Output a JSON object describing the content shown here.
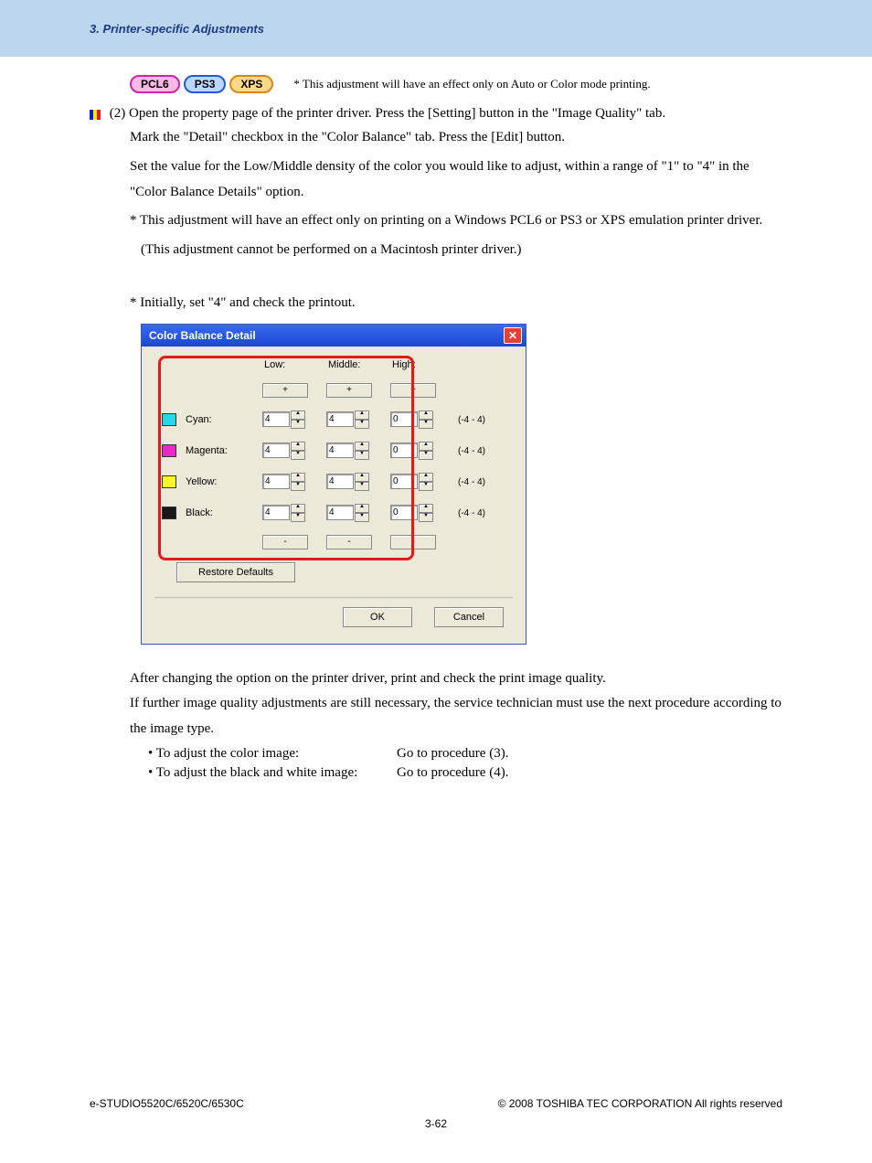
{
  "header": {
    "title": "3. Printer-specific Adjustments"
  },
  "badges": {
    "pcl6": "PCL6",
    "ps3": "PS3",
    "xps": "XPS",
    "note": "* This adjustment will have an effect only on Auto or Color mode printing."
  },
  "step": {
    "num": "(2)",
    "line1": "Open the property page of the printer driver.  Press the [Setting] button in the \"Image Quality\" tab.",
    "line2": "Mark the \"Detail\" checkbox in the \"Color Balance\" tab.  Press the [Edit] button.",
    "line3": "Set the value for the Low/Middle density of the color you would like to adjust, within a range of \"1\" to \"4\" in the \"Color Balance Details\" option."
  },
  "note1": {
    "star": "*",
    "text": "This adjustment will have an effect only on printing on a Windows PCL6 or PS3 or XPS emulation printer driver.",
    "sub": "(This adjustment cannot be performed on a Macintosh printer driver.)"
  },
  "note2": {
    "star": "*",
    "text": "Initially, set \"4\" and check the printout."
  },
  "dialog": {
    "title": "Color Balance Detail",
    "cols": {
      "low": "Low:",
      "middle": "Middle:",
      "high": "High:"
    },
    "plus": "+",
    "minus": "-",
    "rows": [
      {
        "label": "Cyan:",
        "swatch": "sw-c",
        "low": "4",
        "mid": "4",
        "high": "0",
        "range": "(-4 - 4)"
      },
      {
        "label": "Magenta:",
        "swatch": "sw-m",
        "low": "4",
        "mid": "4",
        "high": "0",
        "range": "(-4 - 4)"
      },
      {
        "label": "Yellow:",
        "swatch": "sw-y",
        "low": "4",
        "mid": "4",
        "high": "0",
        "range": "(-4 - 4)"
      },
      {
        "label": "Black:",
        "swatch": "sw-k",
        "low": "4",
        "mid": "4",
        "high": "0",
        "range": "(-4 - 4)"
      }
    ],
    "restore": "Restore Defaults",
    "ok": "OK",
    "cancel": "Cancel"
  },
  "after": {
    "p1": "After changing the option on the printer driver, print and check the print image quality.",
    "p2": "If further image quality adjustments are still necessary, the service technician must use the next procedure according to the image type."
  },
  "procs": [
    {
      "label": "• To adjust the color image:",
      "goto": "Go to procedure (3)."
    },
    {
      "label": "• To adjust the black and white image:",
      "goto": "Go to procedure (4)."
    }
  ],
  "footer": {
    "left": "e-STUDIO5520C/6520C/6530C",
    "right": "© 2008 TOSHIBA TEC CORPORATION All rights reserved",
    "page": "3-62"
  }
}
